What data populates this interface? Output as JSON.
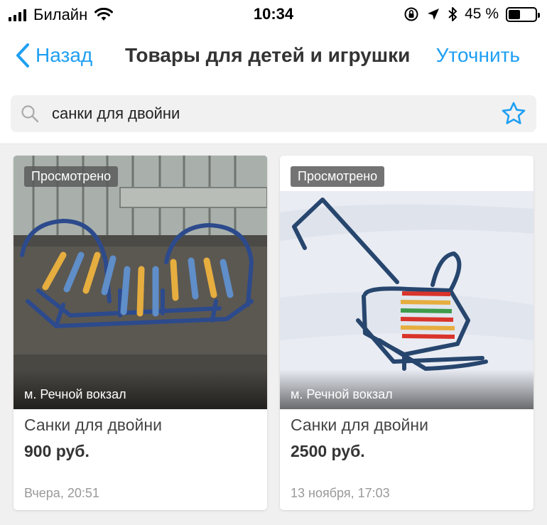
{
  "status": {
    "carrier": "Билайн",
    "time": "10:34",
    "battery_percent": "45 %",
    "battery_level": 0.45
  },
  "nav": {
    "back_label": "Назад",
    "title": "Товары для детей и игрушки",
    "refine_label": "Уточнить"
  },
  "search": {
    "value": "санки для двойни"
  },
  "colors": {
    "accent": "#1e9ff2"
  },
  "listings": [
    {
      "badge": "Просмотрено",
      "metro": "м. Речной вокзал",
      "title": "Санки для двойни",
      "price": "900 руб.",
      "date": "Вчера, 20:51"
    },
    {
      "badge": "Просмотрено",
      "metro": "м. Речной вокзал",
      "title": "Санки для двойни",
      "price": "2500 руб.",
      "date": "13 ноября, 17:03"
    }
  ]
}
